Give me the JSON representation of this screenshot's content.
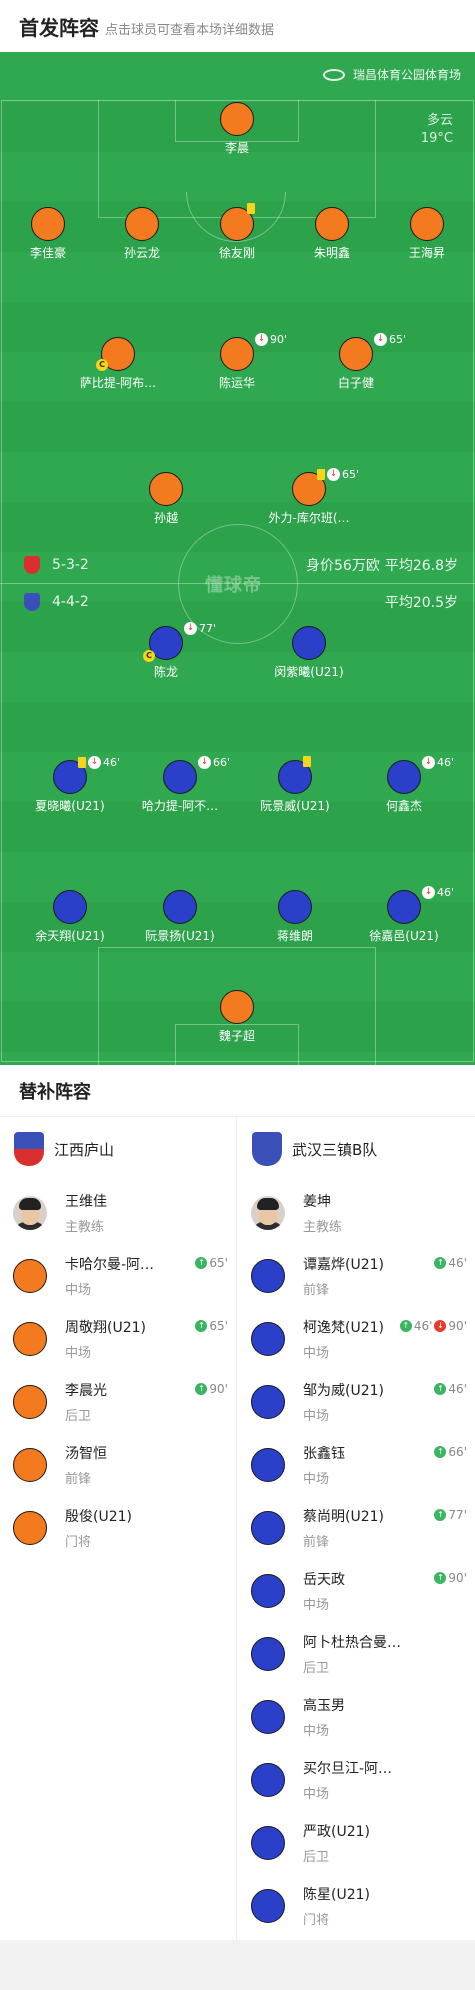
{
  "header": {
    "title": "首发阵容",
    "subtitle": "点击球员可查看本场详细数据"
  },
  "pitch": {
    "venue": "瑞昌体育公园体育场",
    "weather": "多云",
    "temperature": "19°C",
    "watermark": "懂球帝",
    "home_row": {
      "formation": "5-3-2",
      "value": "身价56万欧",
      "avg_age": "平均26.8岁",
      "color": "#d9302f"
    },
    "away_row": {
      "formation": "4-4-2",
      "avg_age": "平均20.5岁",
      "color": "#3b4fb8"
    }
  },
  "home_players": [
    {
      "name": "李晨"
    },
    {
      "name": "李佳豪"
    },
    {
      "name": "孙云龙"
    },
    {
      "name": "徐友刚",
      "yellow": true
    },
    {
      "name": "朱明鑫"
    },
    {
      "name": "王海昇"
    },
    {
      "name": "萨比提-阿布…",
      "captain": "C"
    },
    {
      "name": "陈运华",
      "sub_time": "90'"
    },
    {
      "name": "白子健",
      "sub_time": "65'"
    },
    {
      "name": "孙越"
    },
    {
      "name": "外力-库尔班(…",
      "yellow": true,
      "sub_time": "65'"
    }
  ],
  "away_players": [
    {
      "name": "陈龙",
      "sub_time": "77'",
      "captain": "C"
    },
    {
      "name": "闵紫曦(U21)"
    },
    {
      "name": "夏晓曦(U21)",
      "yellow": true,
      "sub_time": "46'"
    },
    {
      "name": "哈力提-阿不…",
      "sub_time": "66'"
    },
    {
      "name": "阮景威(U21)",
      "yellow": true
    },
    {
      "name": "何鑫杰",
      "sub_time": "46'"
    },
    {
      "name": "余天翔(U21)"
    },
    {
      "name": "阮景扬(U21)"
    },
    {
      "name": "蒋维朗"
    },
    {
      "name": "徐嘉邑(U21)",
      "sub_time": "46'"
    },
    {
      "name": "魏子超"
    }
  ],
  "subs": {
    "title": "替补阵容",
    "home": {
      "team": "江西庐山",
      "coach": {
        "name": "王维佳",
        "role": "主教练"
      },
      "players": [
        {
          "name": "卡哈尔曼-阿…",
          "pos": "中场",
          "in": "65'"
        },
        {
          "name": "周敬翔(U21)",
          "pos": "中场",
          "in": "65'"
        },
        {
          "name": "李晨光",
          "pos": "后卫",
          "in": "90'"
        },
        {
          "name": "汤智恒",
          "pos": "前锋"
        },
        {
          "name": "殷俊(U21)",
          "pos": "门将"
        }
      ]
    },
    "away": {
      "team": "武汉三镇B队",
      "coach": {
        "name": "姜坤",
        "role": "主教练"
      },
      "players": [
        {
          "name": "谭嘉烨(U21)",
          "pos": "前锋",
          "in": "46'"
        },
        {
          "name": "柯逸梵(U21)",
          "pos": "中场",
          "in": "46'",
          "out": "90'"
        },
        {
          "name": "邹为威(U21)",
          "pos": "中场",
          "in": "46'"
        },
        {
          "name": "张鑫钰",
          "pos": "中场",
          "in": "66'"
        },
        {
          "name": "蔡尚明(U21)",
          "pos": "前锋",
          "in": "77'"
        },
        {
          "name": "岳天政",
          "pos": "中场",
          "in": "90'"
        },
        {
          "name": "阿卜杜热合曼…",
          "pos": "后卫"
        },
        {
          "name": "高玉男",
          "pos": "中场"
        },
        {
          "name": "买尔旦江-阿…",
          "pos": "中场"
        },
        {
          "name": "严政(U21)",
          "pos": "后卫"
        },
        {
          "name": "陈星(U21)",
          "pos": "门将"
        }
      ]
    }
  },
  "icons": {
    "sub_out": "↓",
    "sub_in": "↑"
  }
}
